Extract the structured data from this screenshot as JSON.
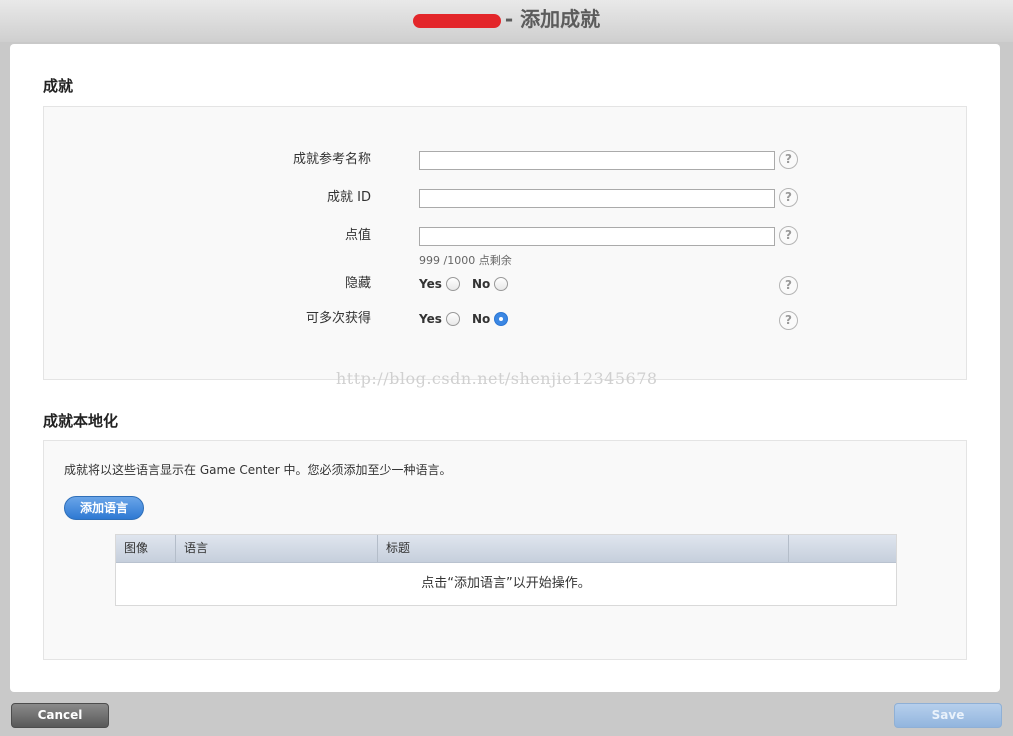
{
  "window": {
    "title": "- 添加成就"
  },
  "achievement": {
    "section_title": "成就",
    "fields": {
      "ref_name": {
        "label": "成就参考名称",
        "value": ""
      },
      "achievement_id": {
        "label": "成就 ID",
        "value": ""
      },
      "points": {
        "label": "点值",
        "value": "",
        "hint": "999 /1000 点剩余"
      }
    },
    "hidden": {
      "label": "隐藏",
      "yes": "Yes",
      "no": "No",
      "selected": "none"
    },
    "multiple": {
      "label": "可多次获得",
      "yes": "Yes",
      "no": "No",
      "selected": "No"
    },
    "help_glyph": "?"
  },
  "watermark": "http://blog.csdn.net/shenjie12345678",
  "localization": {
    "section_title": "成就本地化",
    "description": "成就将以这些语言显示在 Game Center 中。您必须添加至少一种语言。",
    "add_button": "添加语言",
    "table": {
      "columns": [
        "图像",
        "语言",
        "标题",
        ""
      ],
      "empty_message": "点击“添加语言”以开始操作。"
    }
  },
  "footer": {
    "cancel": "Cancel",
    "save": "Save"
  }
}
